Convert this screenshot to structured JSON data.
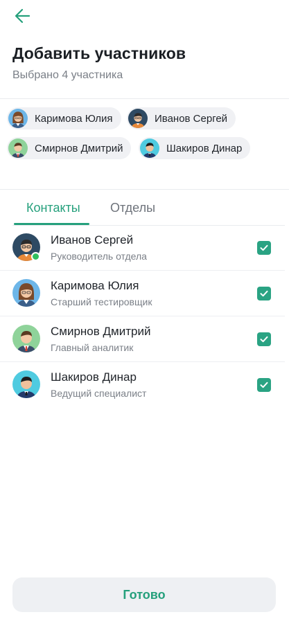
{
  "header": {
    "back_icon": "arrow-left-icon",
    "title": "Добавить участников",
    "subtitle": "Выбрано 4 участника"
  },
  "selected_chips": [
    {
      "name": "Каримова Юлия",
      "avatar": "female-glasses"
    },
    {
      "name": "Иванов Сергей",
      "avatar": "male-glasses-dark"
    },
    {
      "name": "Смирнов Дмитрий",
      "avatar": "male-suit-red-tie"
    },
    {
      "name": "Шакиров Динар",
      "avatar": "male-suit-navy"
    }
  ],
  "tabs": [
    {
      "label": "Контакты",
      "active": true
    },
    {
      "label": "Отделы",
      "active": false
    }
  ],
  "contacts": [
    {
      "name": "Иванов Сергей",
      "role": "Руководитель отдела",
      "online": true,
      "checked": true
    },
    {
      "name": "Каримова Юлия",
      "role": "Старший тестировщик",
      "online": false,
      "checked": true
    },
    {
      "name": "Смирнов Дмитрий",
      "role": "Главный аналитик",
      "online": false,
      "checked": true
    },
    {
      "name": "Шакиров Динар",
      "role": "Ведущий специалист",
      "online": false,
      "checked": true
    }
  ],
  "footer": {
    "done_label": "Готово"
  },
  "colors": {
    "accent": "#25a07c",
    "checkbox": "#2aa383",
    "online": "#2fbf5e",
    "chip_bg": "#f0f1f4",
    "button_bg": "#eef0f3"
  }
}
